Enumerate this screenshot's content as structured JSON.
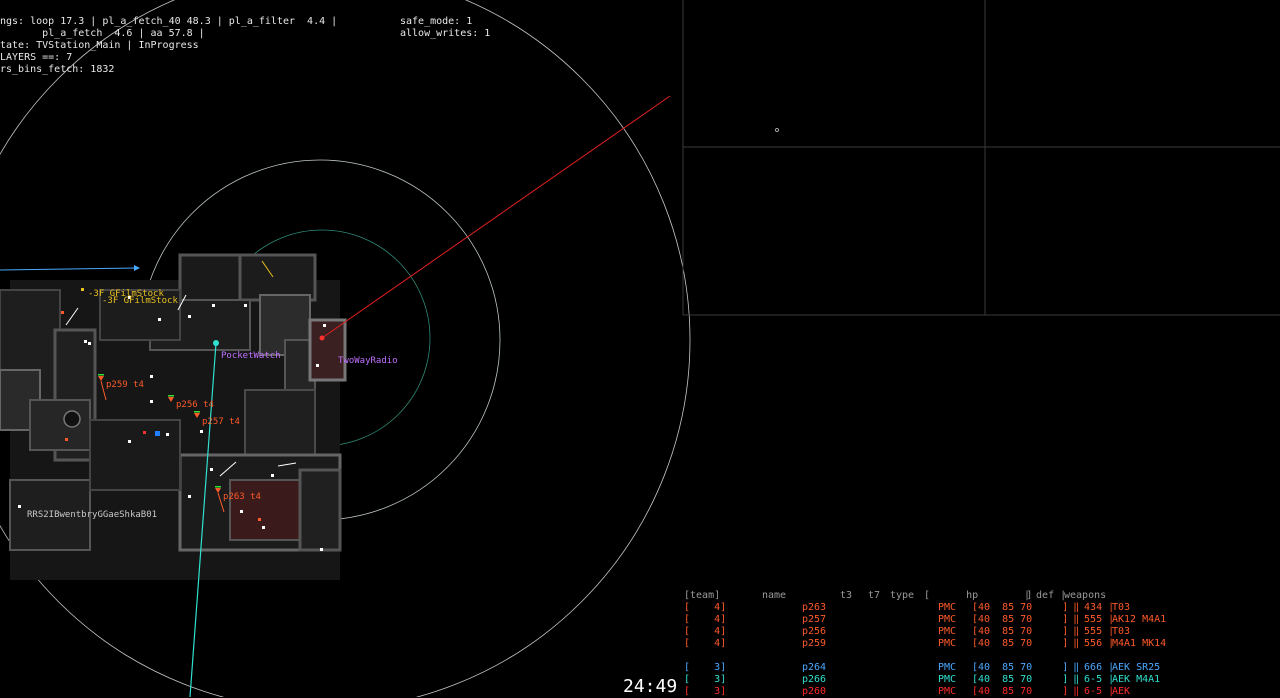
{
  "hud": {
    "line1": "ngs: loop 17.3 | pl_a_fetch_40 48.3 | pl_a_filter  4.4 |",
    "line2": "       pl_a_fetch  4.6 | aa 57.8 |",
    "line3": "tate: TVStation_Main | InProgress",
    "line4": "LAYERS ==: 7",
    "line5": "rs_bins_fetch: 1832"
  },
  "hud_right": {
    "line1": "safe_mode: 1",
    "line2": "allow_writes: 1"
  },
  "map_labels": {
    "item1": "-3F GFilmStock",
    "item2": "-3F GFilmStock",
    "pocket_watch": "PocketWatch",
    "two_way_radio": "TwoWayRadio",
    "overlap_label": "RRS2IBwentbryGGaeShkaB01"
  },
  "players_on_map": [
    {
      "label": "p259 t4",
      "color": "#ff5a2a"
    },
    {
      "label": "p256 t4",
      "color": "#ff5a2a"
    },
    {
      "label": "p257 t4",
      "color": "#ff5a2a"
    },
    {
      "label": "p263 t4",
      "color": "#ff5a2a"
    }
  ],
  "table": {
    "header": {
      "team": "[team]",
      "name": "name",
      "t3": "t3",
      "t7": "t7",
      "type": "type",
      "hp": "[      hp        ]",
      "def": "| def |",
      "weapons": "weapons"
    },
    "rows": [
      {
        "team": "[    4]",
        "name": "p263",
        "type": "PMC",
        "hp": "[40  85 70     ] |",
        "def": "| 434 |",
        "weapons": "T03",
        "color": "#ff5a2a"
      },
      {
        "team": "[    4]",
        "name": "p257",
        "type": "PMC",
        "hp": "[40  85 70     ] |",
        "def": "| 555 |",
        "weapons": "AK12 M4A1",
        "color": "#ff5a2a"
      },
      {
        "team": "[    4]",
        "name": "p256",
        "type": "PMC",
        "hp": "[40  85 70     ] |",
        "def": "| 555 |",
        "weapons": "T03",
        "color": "#ff5a2a"
      },
      {
        "team": "[    4]",
        "name": "p259",
        "type": "PMC",
        "hp": "[40  85 70     ] |",
        "def": "| 556 |",
        "weapons": "M4A1 MK14",
        "color": "#ff5a2a"
      },
      {
        "team": "[    3]",
        "name": "p264",
        "type": "PMC",
        "hp": "[40  85 70     ] |",
        "def": "| 666 |",
        "weapons": "AEK SR25",
        "color": "#4aa8ff"
      },
      {
        "team": "[    3]",
        "name": "p266",
        "type": "PMC",
        "hp": "[40  85 70     ] |",
        "def": "| 6-5 |",
        "weapons": "AEK M4A1",
        "color": "#30e0d0"
      },
      {
        "team": "[    3]",
        "name": "p260",
        "type": "PMC",
        "hp": "[40  85 70     ] |",
        "def": "| 6-5 |",
        "weapons": "AEK",
        "color": "#ff2a2a"
      }
    ]
  },
  "timer": "24:49",
  "colors": {
    "enemy": "#ff5a2a",
    "loot": "#e8c020",
    "quest": "#c070ff",
    "teal": "#30e0d0",
    "blue": "#4aa8ff"
  }
}
